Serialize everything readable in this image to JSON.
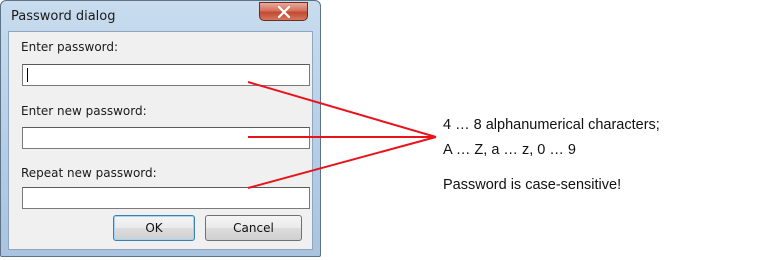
{
  "dialog": {
    "title": "Password dialog",
    "close_label": "X",
    "fields": [
      {
        "label": "Enter password:",
        "value": ""
      },
      {
        "label": "Enter new password:",
        "value": ""
      },
      {
        "label": "Repeat new password:",
        "value": ""
      }
    ],
    "ok_label": "OK",
    "cancel_label": "Cancel"
  },
  "annotation": {
    "lines": [
      "4 … 8 alphanumerical characters;",
      "A … Z, a … z, 0 … 9",
      "Password is case-sensitive!"
    ]
  },
  "colors": {
    "connector": "#e8141b",
    "close_button": "#c94a33"
  },
  "icons": {
    "close": "close-x-icon"
  }
}
